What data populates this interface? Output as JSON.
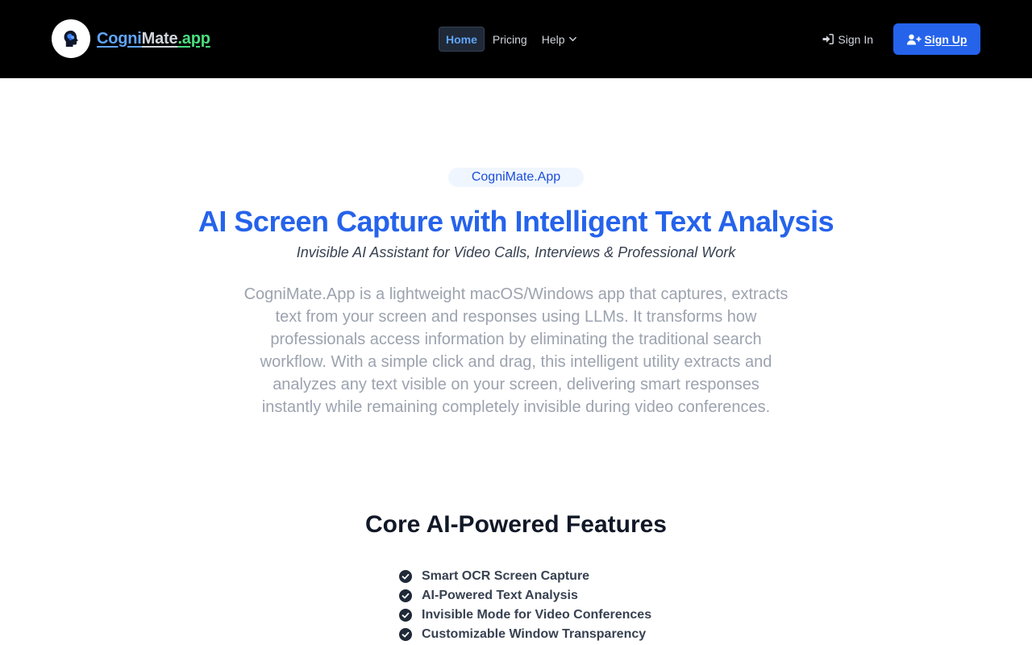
{
  "header": {
    "brand": {
      "part1": "Cogni",
      "part2": "Mate",
      "part3": ".app"
    },
    "nav": {
      "home": "Home",
      "pricing": "Pricing",
      "help": "Help"
    },
    "sign_in": "Sign In",
    "sign_up": "Sign Up"
  },
  "hero": {
    "badge": "CogniMate.App",
    "title": "AI Screen Capture with Intelligent Text Analysis",
    "subtitle": "Invisible AI Assistant for Video Calls, Interviews & Professional Work",
    "description": "CogniMate.App is a lightweight macOS/Windows app that captures, extracts text from your screen and responses using LLMs. It transforms how professionals access information by eliminating the traditional search workflow. With a simple click and drag, this intelligent utility extracts and analyzes any text visible on your screen, delivering smart responses instantly while remaining completely invisible during video conferences."
  },
  "features": {
    "title": "Core AI-Powered Features",
    "items": [
      {
        "label": "Smart OCR Screen Capture"
      },
      {
        "label": "AI-Powered Text Analysis"
      },
      {
        "label": "Invisible Mode for Video Conferences"
      },
      {
        "label": "Customizable Window Transparency"
      }
    ]
  },
  "colors": {
    "accent": "#2563eb",
    "header_bg": "#000000",
    "brand_blue": "#60a5fa",
    "brand_green": "#4ade80"
  },
  "icons": {
    "logo": "head-brain-icon",
    "sign_in": "sign-in-icon",
    "sign_up": "user-plus-icon",
    "help": "chevron-down-icon",
    "feature": "check-circle-icon"
  }
}
